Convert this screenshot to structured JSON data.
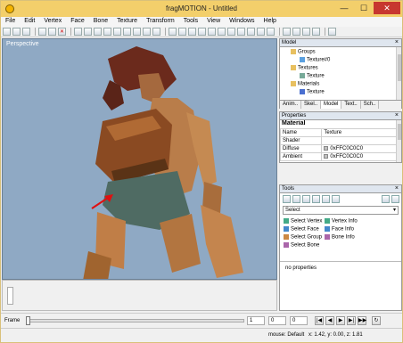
{
  "window": {
    "title": "fragMOTION - Untitled",
    "minimize": "—",
    "maximize": "☐",
    "close": "✕"
  },
  "menu": [
    "File",
    "Edit",
    "Vertex",
    "Face",
    "Bone",
    "Texture",
    "Transform",
    "Tools",
    "View",
    "Windows",
    "Help"
  ],
  "viewport": {
    "label": "Perspective"
  },
  "model_panel": {
    "title": "Model",
    "tree": [
      {
        "label": "Groups",
        "indent": 1
      },
      {
        "label": "Texture#0",
        "indent": 2
      },
      {
        "label": "Textures",
        "indent": 1
      },
      {
        "label": "Texture",
        "indent": 2
      },
      {
        "label": "Materials",
        "indent": 1
      },
      {
        "label": "Texture",
        "indent": 2
      }
    ],
    "tabs": [
      "Anim..",
      "Skel..",
      "Model",
      "Text..",
      "Sch.."
    ]
  },
  "properties_panel": {
    "title": "Properties",
    "section": "Material",
    "rows": [
      {
        "name": "Name",
        "value": "Texture"
      },
      {
        "name": "Shader",
        "value": ""
      },
      {
        "name": "Diffuse",
        "value": "0xFFC0C0C0"
      },
      {
        "name": "Ambient",
        "value": "0xFFC0C0C0"
      }
    ]
  },
  "tools_panel": {
    "title": "Tools",
    "select_value": "Select",
    "items_left": [
      "Select Vertex",
      "Select Face",
      "Select Group",
      "Select Bone"
    ],
    "items_right": [
      "Vertex Info",
      "Face Info",
      "Bone Info"
    ],
    "no_properties": "no properties"
  },
  "frame_bar": {
    "label": "Frame",
    "start": "1",
    "current": "0",
    "end": "0"
  },
  "status": {
    "mouse": "mouse: Default",
    "coords": "x: 1.42, y: 0.00, z: 1.81"
  }
}
